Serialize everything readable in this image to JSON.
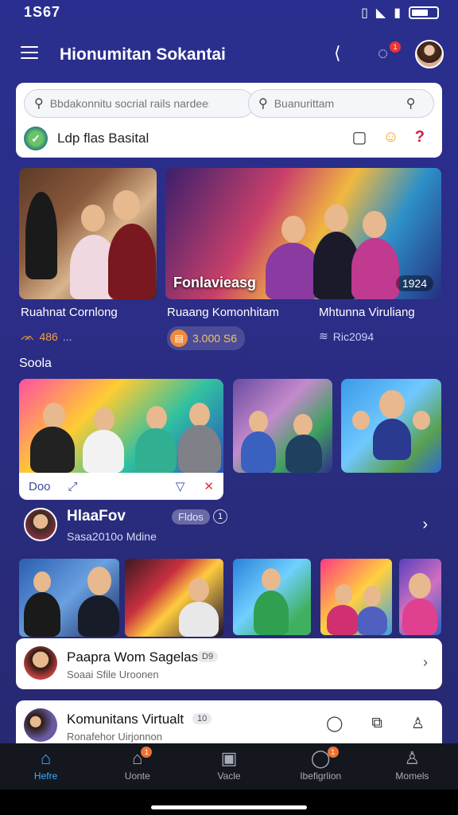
{
  "status_bar": {
    "time": "1S67"
  },
  "header": {
    "title": "Hionumitan Sokantai",
    "notif_count": "1"
  },
  "search": {
    "primary_placeholder": "Bbdakonnitu socrial rails nardees",
    "secondary_placeholder": "Buanurittam",
    "row_label": "Ldp flas Basital"
  },
  "featured": [
    {
      "title": "Ruahnat Cornlong",
      "stat": "486",
      "stat_extra": "..."
    },
    {
      "title": "Ruaang Komonhitam",
      "caption": "Fonlavieasg",
      "badge": "1924",
      "stat": "3.000 S6"
    },
    {
      "title": "Mhtunna Viruliang",
      "stat": "Ric2094"
    }
  ],
  "section": {
    "label": "Soola"
  },
  "feature_card": {
    "action_label": "Doo"
  },
  "user": {
    "name": "HlaaFov",
    "tag": "Fldos",
    "count": "1",
    "sub": "Sasa2010o Mdine"
  },
  "list": [
    {
      "title": "Paapra Wom Sagelas",
      "tag": "D9",
      "sub": "Soaai Sfile Uroonen"
    },
    {
      "title": "Komunitans Virtualt",
      "tag": "10",
      "sub": "Ronafehor Uirjonnon"
    }
  ],
  "nav": [
    {
      "label": "Hefre",
      "icon": "home-icon",
      "active": true
    },
    {
      "label": "Uonte",
      "icon": "house-icon",
      "badge": "1"
    },
    {
      "label": "Vacle",
      "icon": "video-icon"
    },
    {
      "label": "Ibefigrlion",
      "icon": "chat-icon",
      "badge": "1"
    },
    {
      "label": "Momels",
      "icon": "person-icon"
    }
  ],
  "colors": {
    "accent": "#38b0ff",
    "background": "#2a2f8f",
    "badge": "#f07030"
  }
}
